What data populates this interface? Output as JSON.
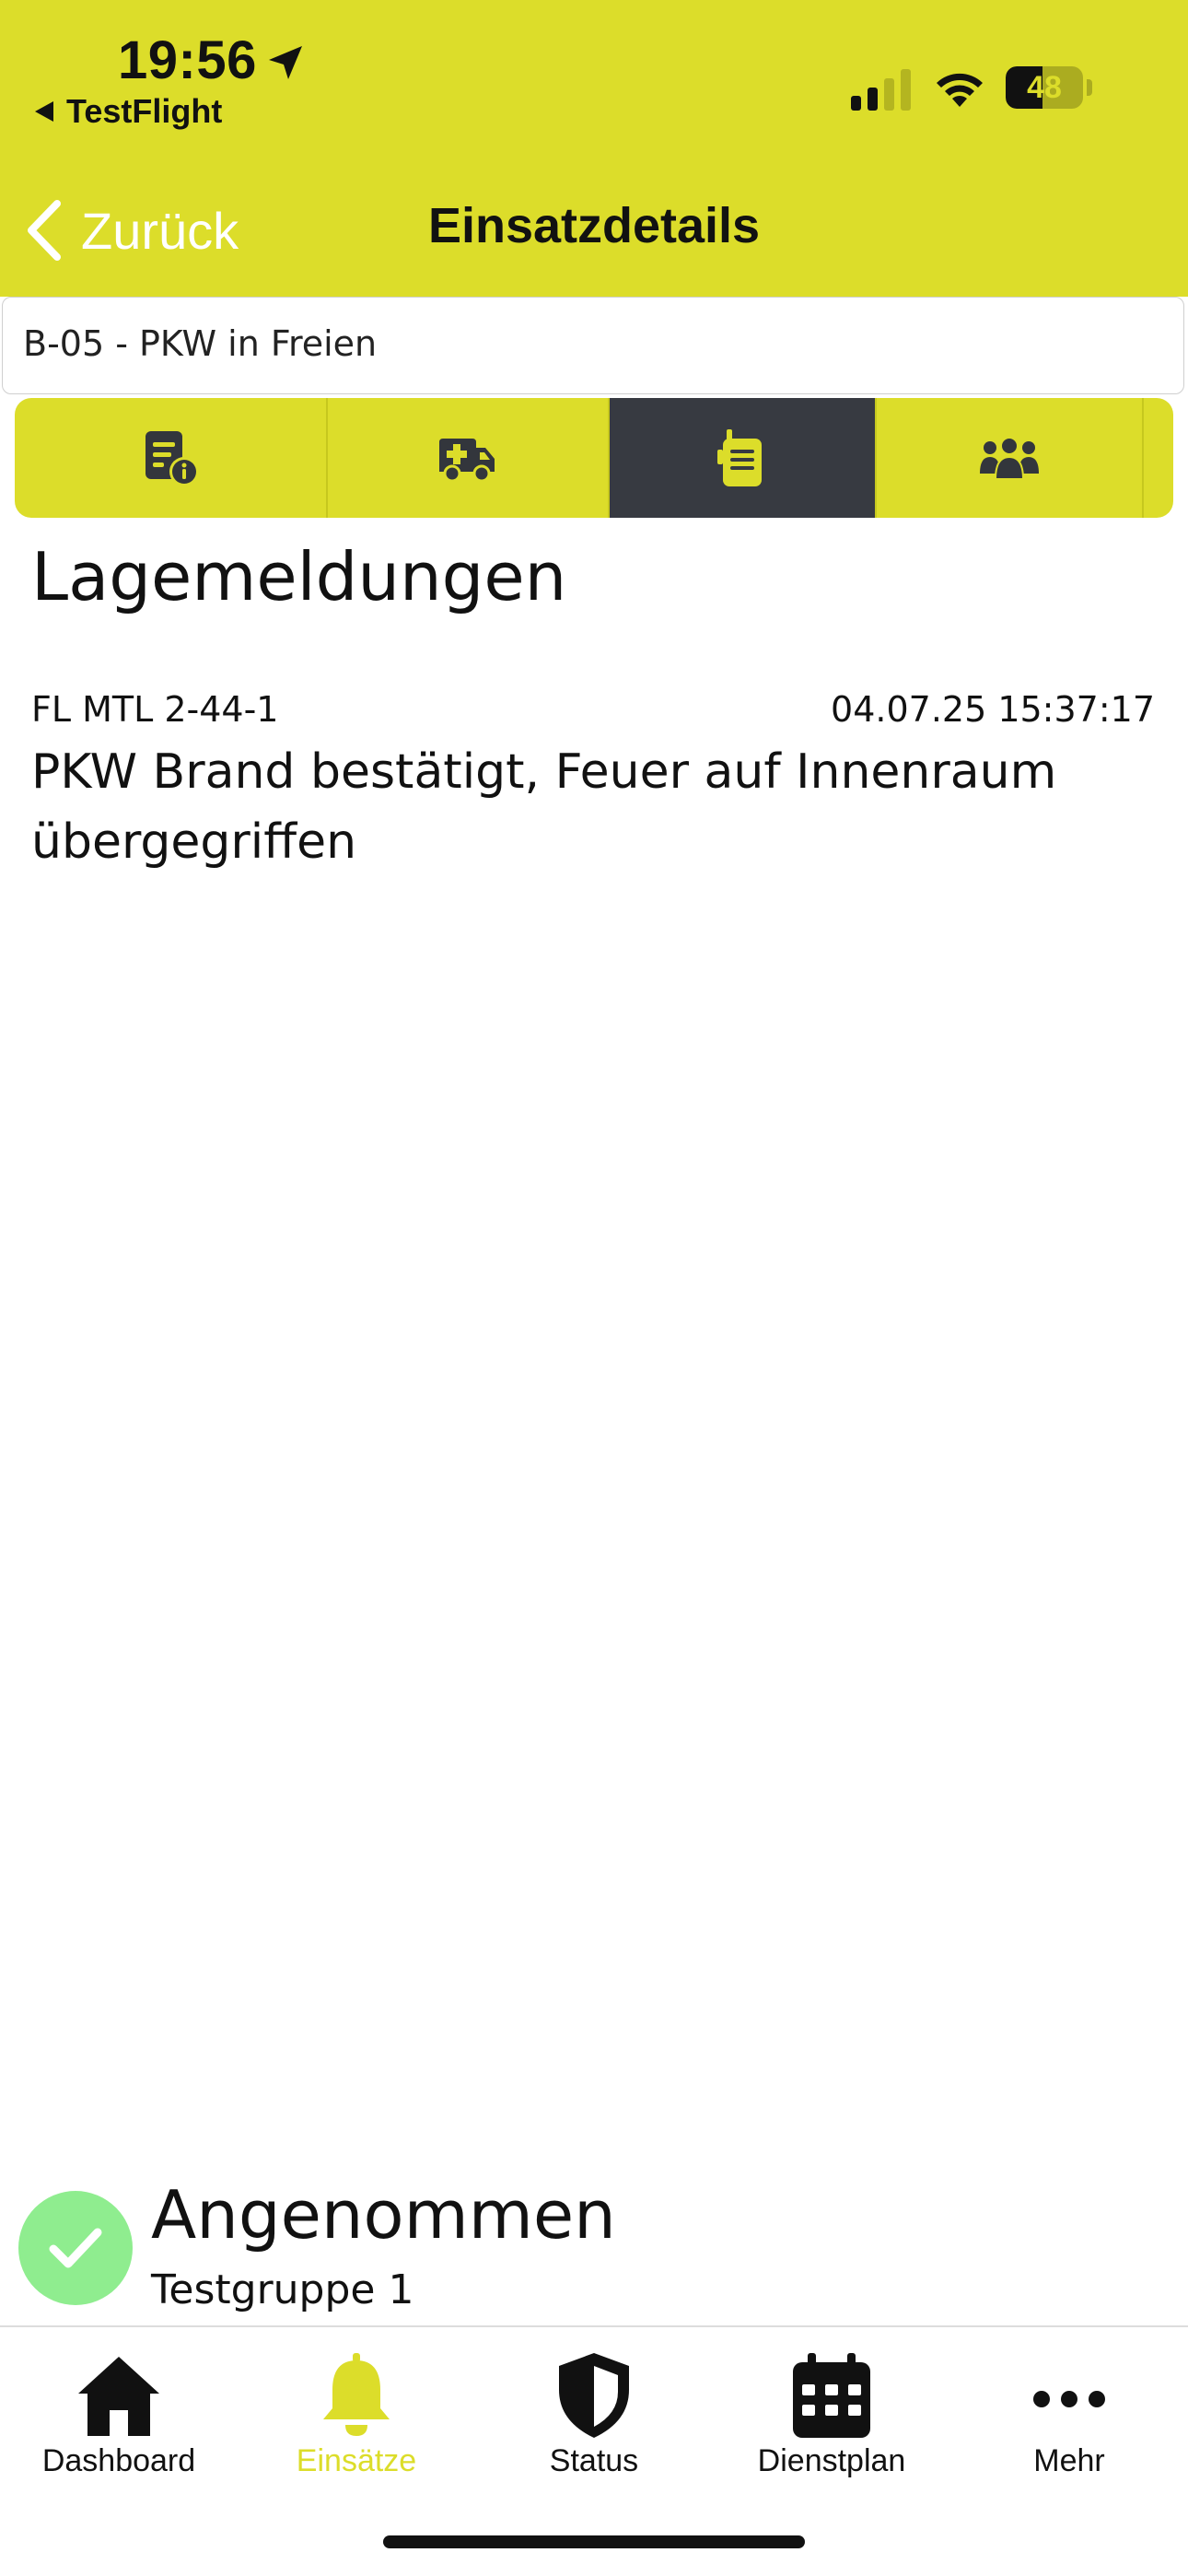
{
  "status_bar": {
    "time": "19:56",
    "back_app": "TestFlight",
    "battery_percent": "48",
    "battery_level": 0.48
  },
  "navbar": {
    "back_label": "Zurück",
    "title": "Einsatzdetails"
  },
  "mission": {
    "title": "B-05 - PKW in Freien"
  },
  "segments": [
    {
      "icon": "report-info-icon",
      "active": false
    },
    {
      "icon": "ambulance-icon",
      "active": false
    },
    {
      "icon": "radio-icon",
      "active": true
    },
    {
      "icon": "people-group-icon",
      "active": false
    }
  ],
  "content": {
    "heading": "Lagemeldungen",
    "messages": [
      {
        "sender": "FL MTL 2-44-1",
        "timestamp": "04.07.25 15:37:17",
        "text": "PKW Brand bestätigt, Feuer auf Innenraum übergegriffen"
      }
    ]
  },
  "response": {
    "status": "Angenommen",
    "group": "Testgruppe 1"
  },
  "tabbar": {
    "tabs": [
      {
        "label": "Dashboard",
        "icon": "home-icon",
        "active": false
      },
      {
        "label": "Einsätze",
        "icon": "bell-icon",
        "active": true
      },
      {
        "label": "Status",
        "icon": "shield-icon",
        "active": false
      },
      {
        "label": "Dienstplan",
        "icon": "calendar-icon",
        "active": false
      },
      {
        "label": "Mehr",
        "icon": "more-dots-icon",
        "active": false
      }
    ]
  },
  "colors": {
    "accent": "#dcdd2a",
    "active_segment": "#373a41",
    "accepted": "#8fed8f"
  }
}
